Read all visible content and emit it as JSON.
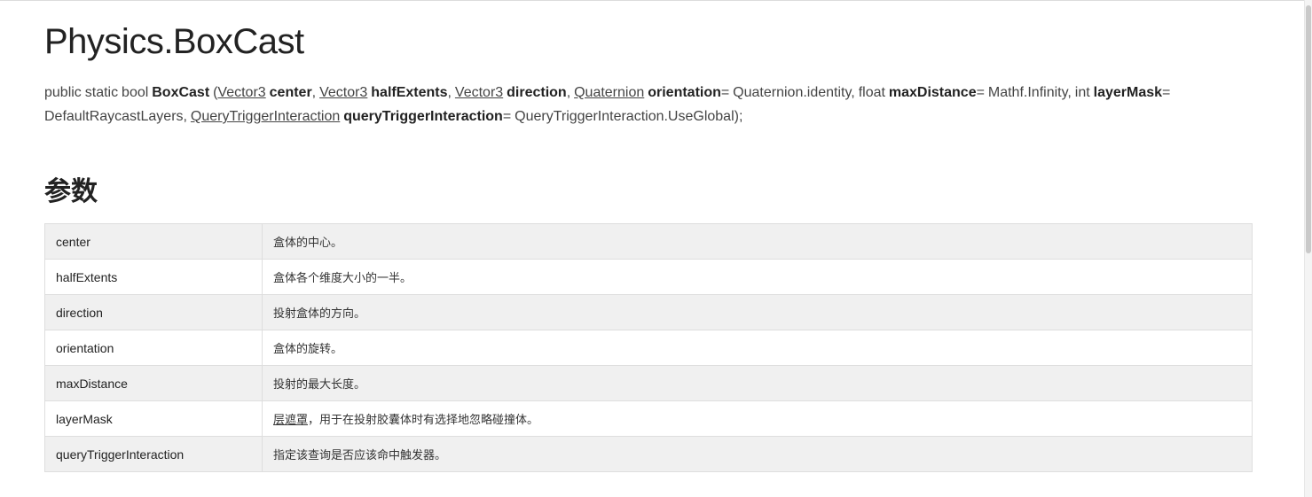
{
  "title": "Physics.BoxCast",
  "signature": {
    "prefix": "public static bool ",
    "method": "BoxCast",
    "paren_open": " (",
    "type_vector3_a": "Vector3",
    "param_center": "center",
    "sep1": ", ",
    "type_vector3_b": "Vector3",
    "param_halfExtents": "halfExtents",
    "sep2": ", ",
    "type_vector3_c": "Vector3",
    "param_direction": "direction",
    "sep3": ", ",
    "type_quaternion": "Quaternion",
    "param_orientation": "orientation",
    "default_orientation": "= Quaternion.identity, float ",
    "param_maxDistance": "maxDistance",
    "default_maxDistance": "= Mathf.Infinity, int ",
    "param_layerMask": "layerMask",
    "default_layerMask": "= DefaultRaycastLayers, ",
    "type_qti": "QueryTriggerInteraction",
    "param_qti": "queryTriggerInteraction",
    "default_qti": "= QueryTriggerInteraction.UseGlobal);"
  },
  "params_heading": "参数",
  "params": [
    {
      "name": "center",
      "desc": "盒体的中心。"
    },
    {
      "name": "halfExtents",
      "desc": "盒体各个维度大小的一半。"
    },
    {
      "name": "direction",
      "desc": "投射盒体的方向。"
    },
    {
      "name": "orientation",
      "desc": "盒体的旋转。"
    },
    {
      "name": "maxDistance",
      "desc": "投射的最大长度。"
    },
    {
      "name": "layerMask",
      "desc_link": "层遮罩",
      "desc": "，用于在投射胶囊体时有选择地忽略碰撞体。"
    },
    {
      "name": "queryTriggerInteraction",
      "desc": "指定该查询是否应该命中触发器。"
    }
  ]
}
